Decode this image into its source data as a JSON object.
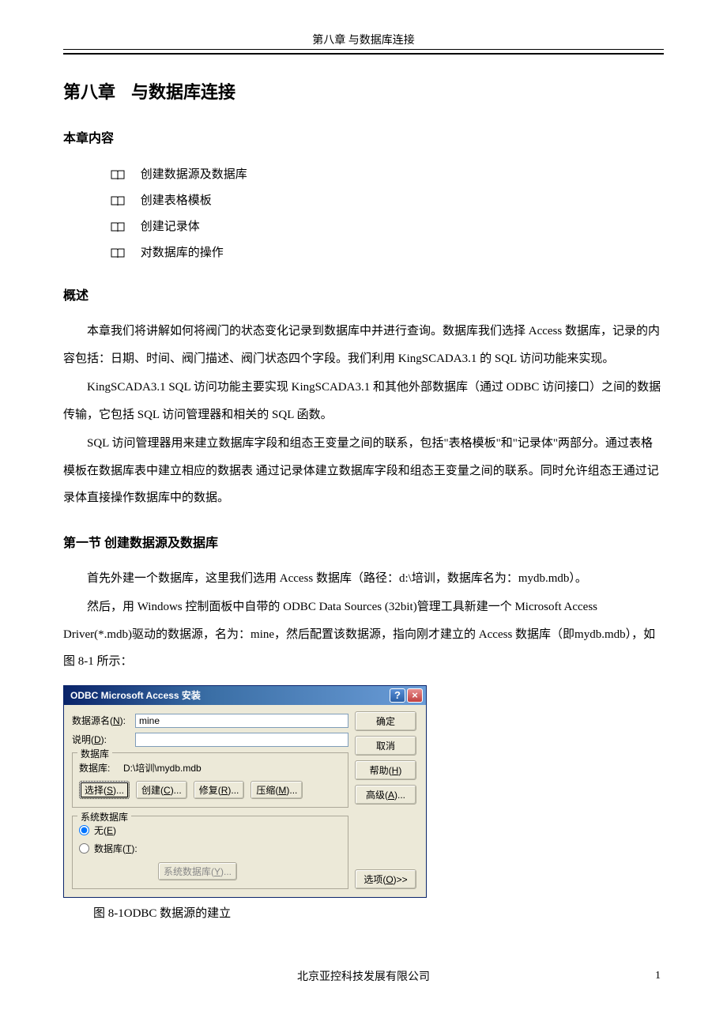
{
  "header": "第八章 与数据库连接",
  "chapter_title_a": "第八章",
  "chapter_title_b": "与数据库连接",
  "toc_heading": "本章内容",
  "toc_items": [
    "创建数据源及数据库",
    "创建表格模板",
    "创建记录体",
    "对数据库的操作"
  ],
  "overview_heading": "概述",
  "overview_p1": "本章我们将讲解如何将阀门的状态变化记录到数据库中并进行查询。数据库我们选择 Access 数据库，记录的内容包括：日期、时间、阀门描述、阀门状态四个字段。我们利用 KingSCADA3.1 的 SQL 访问功能来实现。",
  "overview_p2": "KingSCADA3.1 SQL 访问功能主要实现 KingSCADA3.1 和其他外部数据库（通过 ODBC 访问接口）之间的数据传输，它包括 SQL 访问管理器和相关的 SQL 函数。",
  "overview_p3": "SQL 访问管理器用来建立数据库字段和组态王变量之间的联系，包括\"表格模板\"和\"记录体\"两部分。通过表格模板在数据库表中建立相应的数据表  通过记录体建立数据库字段和组态王变量之间的联系。同时允许组态王通过记录体直接操作数据库中的数据。",
  "section1_heading": "第一节  创建数据源及数据库",
  "section1_p1": "首先外建一个数据库，这里我们选用 Access 数据库（路径：d:\\培训，数据库名为：mydb.mdb）。",
  "section1_p2": "然后，用 Windows 控制面板中自带的 ODBC Data Sources (32bit)管理工具新建一个 Microsoft Access Driver(*.mdb)驱动的数据源，名为：mine，然后配置该数据源，指向刚才建立的 Access 数据库（即mydb.mdb），如图 8-1 所示：",
  "dialog": {
    "title": "ODBC Microsoft Access 安装",
    "help_char": "?",
    "close_char": "×",
    "dsn_label": "数据源名(N):",
    "dsn_value": "mine",
    "desc_label": "说明(D):",
    "desc_value": "",
    "db_legend": "数据库",
    "db_path_label": "数据库:",
    "db_path_value": "D:\\培训\\mydb.mdb",
    "btn_select": "选择(S)...",
    "btn_create": "创建(C)...",
    "btn_repair": "修复(R)...",
    "btn_compact": "压缩(M)...",
    "sysdb_legend": "系统数据库",
    "radio_none": "无(E)",
    "radio_db": "数据库(T):",
    "btn_sysdb": "系统数据库(Y)...",
    "btn_ok": "确定",
    "btn_cancel": "取消",
    "btn_help": "帮助(H)",
    "btn_advanced": "高级(A)...",
    "btn_options": "选项(O)>>"
  },
  "figure_caption": "图 8-1ODBC 数据源的建立",
  "footer_company": "北京亚控科技发展有限公司",
  "footer_page": "1"
}
